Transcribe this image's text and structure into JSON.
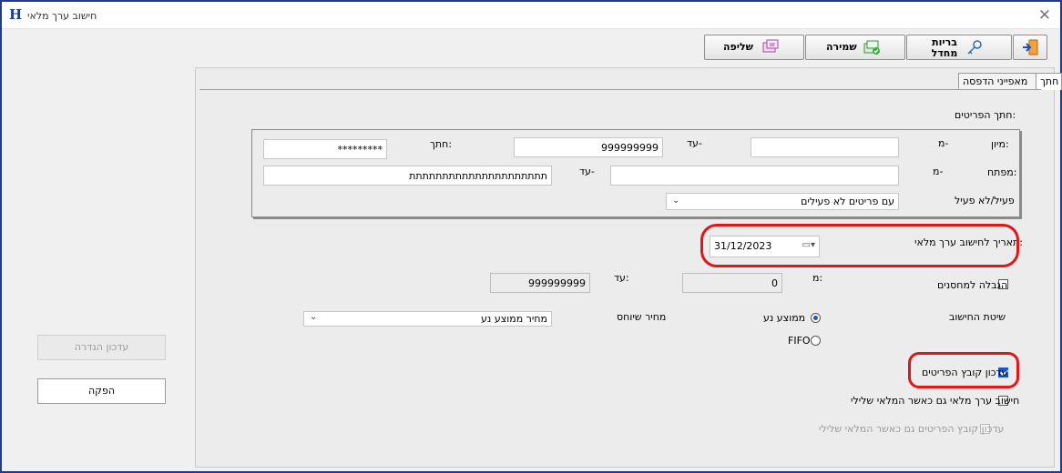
{
  "window": {
    "title": "חישוב ערך מלאי",
    "app_icon": "H"
  },
  "toolbar": {
    "exit_icon": "exit-door-icon",
    "password_line1": "בריות",
    "password_line2": "מחדל",
    "save_label": "שמירה",
    "fetch_label": "שליפה"
  },
  "tabs": {
    "filter": "חתך",
    "print": "מאפייני הדפסה"
  },
  "filter": {
    "section_title": "חתך הפריטים:",
    "sort_label": "מיון:",
    "from_label": "מ-",
    "to_label": "עד-",
    "sort_from": "",
    "sort_to": "999999999",
    "cut_label": "חתך:",
    "cut_value": "*********",
    "key_label": "מפתח:",
    "key_from_label": "מ-",
    "key_to_label": "עד-",
    "key_from": "",
    "key_to": "תתתתתתתתתתתתתתתתתתתתת",
    "active_label": "פעיל/לא פעיל",
    "active_value": "עם פריטים לא פעילים"
  },
  "calc_date": {
    "label": "תאריך לחישוב ערך מלאי:",
    "value": "31/12/2023"
  },
  "warehouses": {
    "label": "הגבלה למחסנים",
    "checked": false,
    "from_label": "מ:",
    "to_label": "עד:",
    "from_value": "0",
    "to_value": "999999999"
  },
  "method": {
    "label": "שיטת החישוב",
    "option_avg": "ממוצע נע",
    "option_fifo": "FIFO",
    "selected": "ממוצע נע",
    "price_label": "מחיר שיוחס",
    "price_value": "מחיר ממוצע נע"
  },
  "options": {
    "update_items_label": "עדכון קובץ הפריטים",
    "update_items_checked": true,
    "calc_negative_label": "חישוב ערך מלאי גם כאשר המלאי שלילי",
    "calc_negative_checked": false,
    "update_negative_label": "עדכון קובץ הפריטים גם כאשר המלאי שלילי",
    "update_negative_checked": false
  },
  "side": {
    "update_def_label": "עדכון הגדרה",
    "produce_label": "הפקה"
  },
  "colors": {
    "highlight": "#e0161b",
    "accent": "#1a57c4",
    "border": "#1f3b8a"
  }
}
